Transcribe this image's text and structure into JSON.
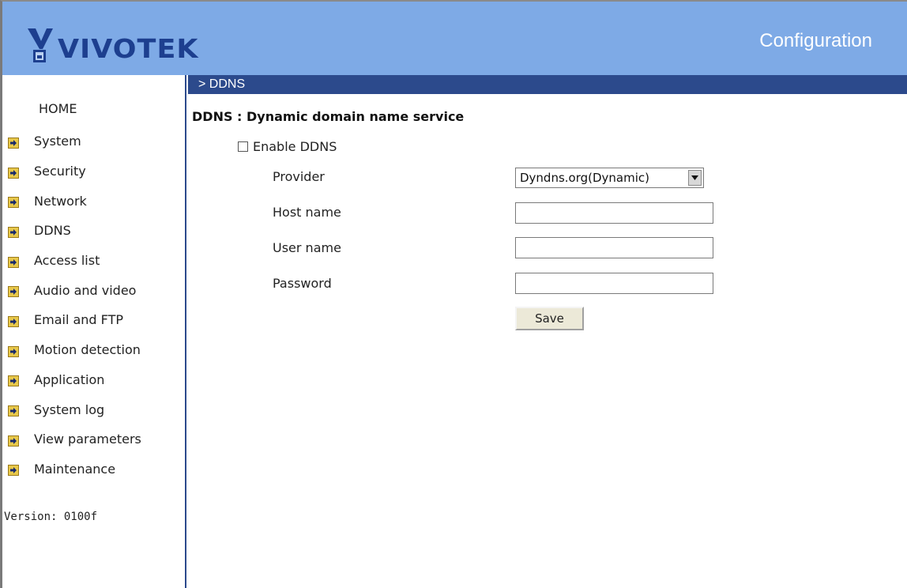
{
  "header": {
    "brand": "VIVOTEK",
    "title": "Configuration",
    "colors": {
      "header_bg": "#7eaae6",
      "logo_text": "#1d3f8f",
      "bar": "#2c4a8c"
    }
  },
  "sidebar": {
    "home": "HOME",
    "items": [
      {
        "label": "System",
        "icon": "arrow-icon"
      },
      {
        "label": "Security",
        "icon": "arrow-icon"
      },
      {
        "label": "Network",
        "icon": "arrow-icon"
      },
      {
        "label": "DDNS",
        "icon": "arrow-icon"
      },
      {
        "label": "Access list",
        "icon": "arrow-icon"
      },
      {
        "label": "Audio and video",
        "icon": "arrow-icon"
      },
      {
        "label": "Email and FTP",
        "icon": "arrow-icon"
      },
      {
        "label": "Motion detection",
        "icon": "arrow-icon"
      },
      {
        "label": "Application",
        "icon": "arrow-icon"
      },
      {
        "label": "System log",
        "icon": "arrow-icon"
      },
      {
        "label": "View parameters",
        "icon": "arrow-icon"
      },
      {
        "label": "Maintenance",
        "icon": "arrow-icon"
      }
    ],
    "version": "Version: 0100f"
  },
  "main": {
    "breadcrumb": "> DDNS",
    "section_title": "DDNS : Dynamic domain name service",
    "enable_label": "Enable DDNS",
    "enable_checked": false,
    "provider_label": "Provider",
    "provider_value": "Dyndns.org(Dynamic)",
    "host_label": "Host name",
    "host_value": "",
    "user_label": "User name",
    "user_value": "",
    "password_label": "Password",
    "password_value": "",
    "save_label": "Save"
  }
}
